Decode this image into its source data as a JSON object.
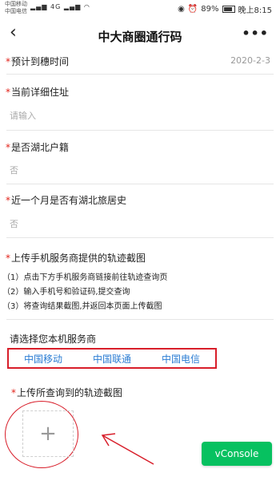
{
  "status": {
    "carrier1": "中国移动",
    "carrier2": "中国电信",
    "network": "4G",
    "battery": "89%",
    "time": "晚上8:15"
  },
  "nav": {
    "back": "‹",
    "title": "中大商圈通行码",
    "more": "•••"
  },
  "form": {
    "arrival_time": {
      "label": "预计到穗时间",
      "value": "2020-2-3"
    },
    "address": {
      "label": "当前详细住址",
      "placeholder": "请输入"
    },
    "hubei_hukou": {
      "label": "是否湖北户籍",
      "value": "否"
    },
    "hubei_travel": {
      "label": "近一个月是否有湖北旅居史",
      "value": "否"
    },
    "upload_tracks": {
      "label": "上传手机服务商提供的轨迹截图",
      "steps": [
        "（1）点击下方手机服务商链接前往轨迹查询页",
        "（2）输入手机号和验证码,提交查询",
        "（3）将查询结果截图,并返回本页面上传截图"
      ]
    },
    "provider_prompt": "请选择您本机服务商",
    "providers": [
      "中国移动",
      "中国联通",
      "中国电信"
    ],
    "upload_label": "上传所查询到的轨迹截图",
    "upload_plus": "+"
  },
  "vconsole": {
    "label": "vConsole"
  },
  "colors": {
    "required": "#e2231a",
    "link": "#2b7cd3",
    "green": "#07c160",
    "highlight": "#d81e2a"
  }
}
